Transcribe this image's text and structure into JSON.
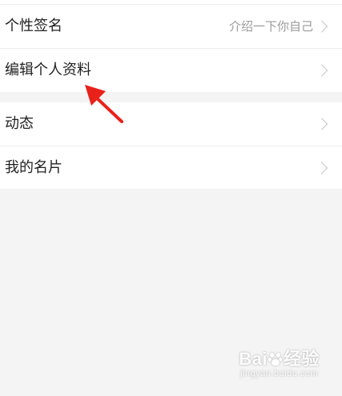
{
  "group1": {
    "signature": {
      "label": "个性签名",
      "value": "介绍一下你自己"
    },
    "edit_profile": {
      "label": "编辑个人资料"
    }
  },
  "group2": {
    "moments": {
      "label": "动态"
    },
    "my_card": {
      "label": "我的名片"
    }
  },
  "colors": {
    "background": "#f4f4f4",
    "arrow": "#e8221b"
  },
  "watermark": {
    "brand": "Bai",
    "brand_suffix": "经验",
    "url": "jingyan.baidu.com"
  }
}
